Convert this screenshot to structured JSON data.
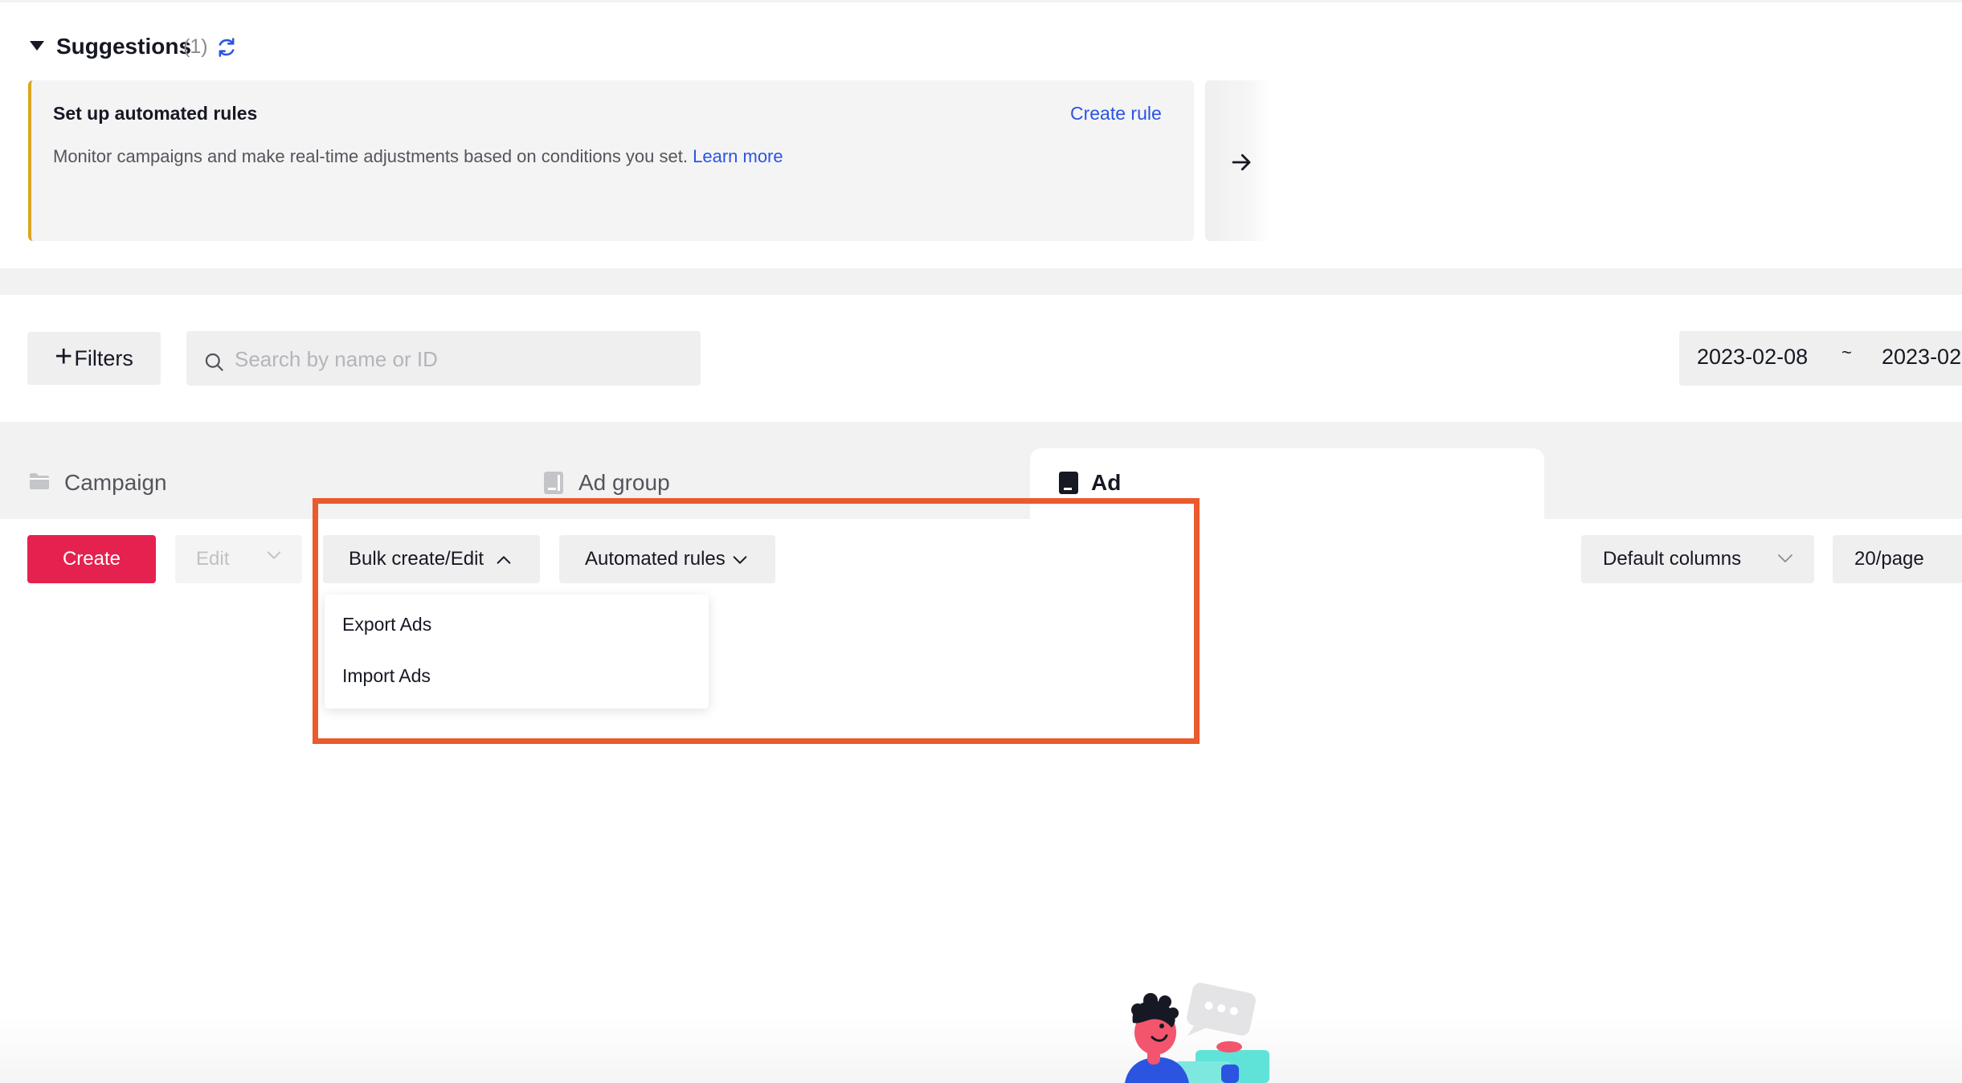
{
  "suggestions": {
    "title": "Suggestions",
    "count": "(1)",
    "card": {
      "title": "Set up automated rules",
      "description": "Monitor campaigns and make real-time adjustments based on conditions you set.",
      "learn_more": "Learn more",
      "action": "Create rule"
    }
  },
  "filters": {
    "button_label": "Filters",
    "search_placeholder": "Search by name or ID",
    "date_start": "2023-02-08",
    "date_separator": "~",
    "date_end": "2023-02"
  },
  "tabs": [
    {
      "label": "Campaign",
      "active": false
    },
    {
      "label": "Ad group",
      "active": false
    },
    {
      "label": "Ad",
      "active": true
    }
  ],
  "toolbar": {
    "create": "Create",
    "edit": "Edit",
    "bulk": "Bulk create/Edit",
    "automated_rules": "Automated rules",
    "default_columns": "Default columns",
    "page_size": "20/page"
  },
  "bulk_menu": {
    "items": [
      "Export Ads",
      "Import Ads"
    ]
  },
  "colors": {
    "accent": "#e5224f",
    "link": "#2b55e0",
    "highlight": "#ea5a2c",
    "suggestion_bar": "#d9a620"
  }
}
